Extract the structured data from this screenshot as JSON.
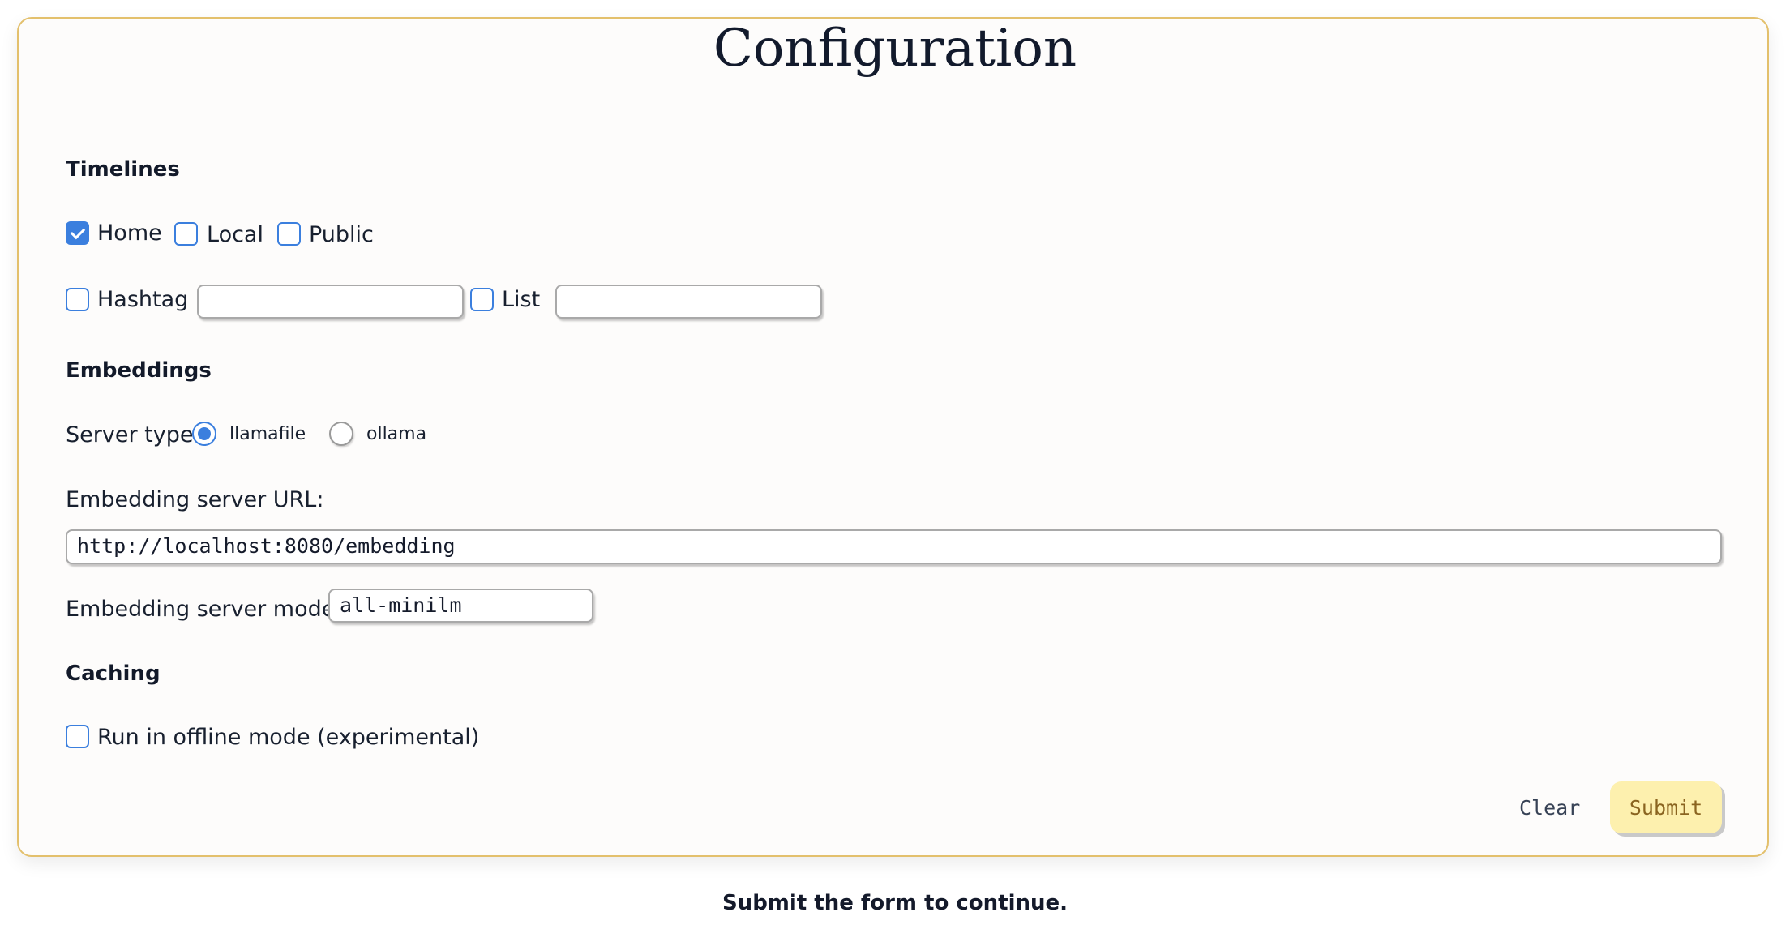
{
  "title": "Configuration",
  "sections": {
    "timelines": {
      "heading": "Timelines",
      "options": [
        {
          "label": "Home",
          "checked": true
        },
        {
          "label": "Local",
          "checked": false
        },
        {
          "label": "Public",
          "checked": false
        }
      ],
      "hashtag": {
        "label": "Hashtag",
        "checked": false,
        "value": ""
      },
      "list": {
        "label": "List",
        "checked": false,
        "value": ""
      }
    },
    "embeddings": {
      "heading": "Embeddings",
      "server_type_label": "Server type:",
      "server_types": [
        {
          "label": "llamafile",
          "selected": true
        },
        {
          "label": "ollama",
          "selected": false
        }
      ],
      "url_label": "Embedding server URL:",
      "url_value": "http://localhost:8080/embedding",
      "model_label": "Embedding server model:",
      "model_value": "all-minilm"
    },
    "caching": {
      "heading": "Caching",
      "offline_label": "Run in offline mode (experimental)",
      "offline_checked": false
    }
  },
  "buttons": {
    "clear": "Clear",
    "submit": "Submit"
  },
  "footer": "Submit the form to continue.",
  "colors": {
    "accent": "#3b7fde",
    "card_border": "#e3c06c",
    "submit_bg": "#fdf0ae",
    "submit_text": "#8a6420"
  }
}
